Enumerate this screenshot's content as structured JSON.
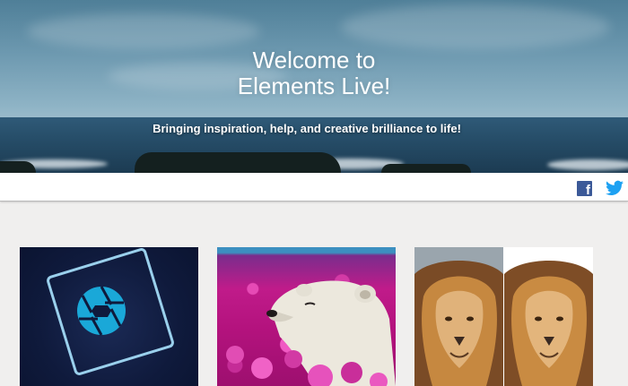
{
  "hero": {
    "title_line1": "Welcome to",
    "title_line2": "Elements Live!",
    "tagline": "Bringing inspiration, help, and creative brilliance to life!"
  },
  "social": {
    "facebook_icon": "facebook-icon",
    "twitter_icon": "twitter-icon",
    "facebook_color": "#3b5998",
    "twitter_color": "#1da1f2"
  },
  "cards": [
    {
      "image": "photoshop-elements-logo"
    },
    {
      "image": "polar-bear-in-flowers"
    },
    {
      "image": "lion-comparison"
    }
  ]
}
